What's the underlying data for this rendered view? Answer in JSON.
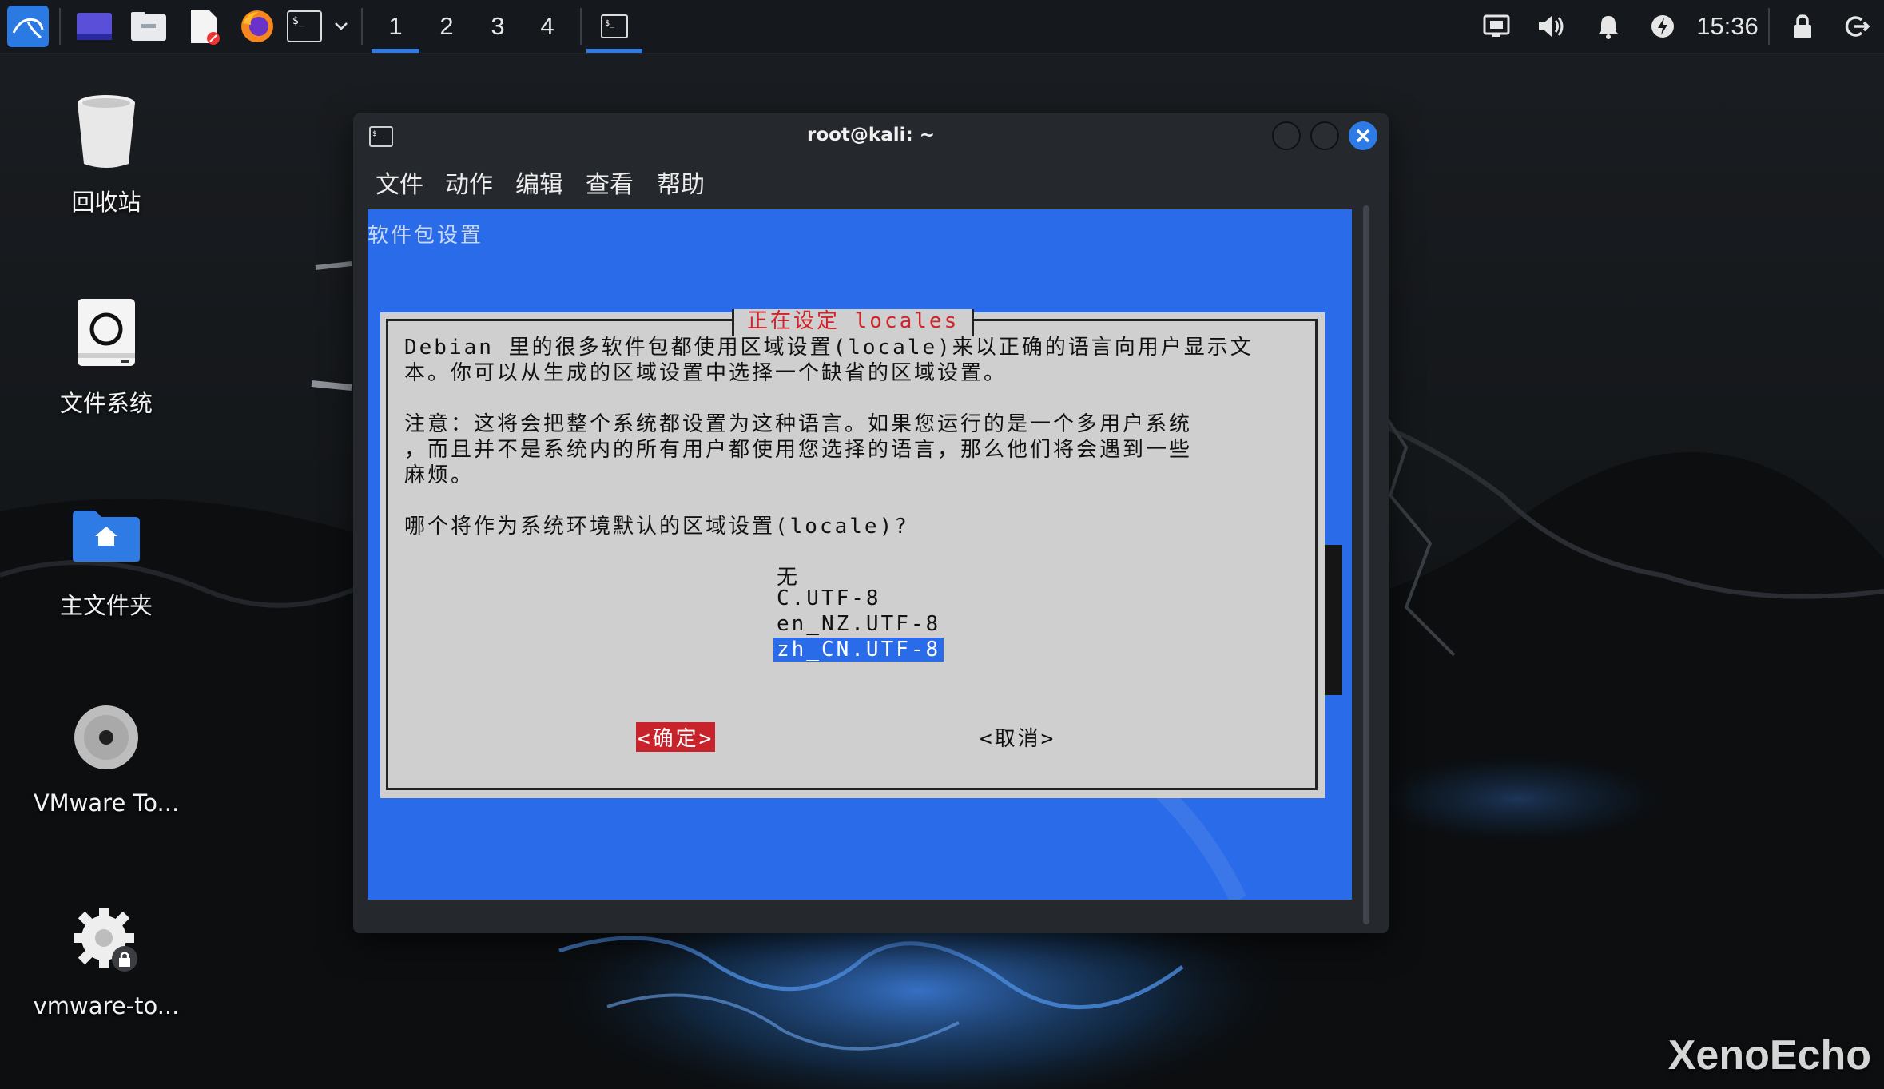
{
  "panel": {
    "workspaces": [
      "1",
      "2",
      "3",
      "4"
    ],
    "active_workspace": "1",
    "clock": "15:36",
    "icons": [
      "kali-menu-icon",
      "desktop-icon",
      "file-manager-icon",
      "text-editor-icon",
      "firefox-icon",
      "terminal-icon",
      "dropdown-chevron-icon",
      "terminal-task-icon",
      "network-icon",
      "volume-icon",
      "notification-bell-icon",
      "power-manager-icon",
      "lock-icon",
      "logout-icon"
    ]
  },
  "desktop": {
    "icons": [
      {
        "label": "回收站",
        "icon": "trash-icon"
      },
      {
        "label": "文件系统",
        "icon": "filesystem-drive-icon"
      },
      {
        "label": "主文件夹",
        "icon": "home-folder-icon"
      },
      {
        "label": "VMware To...",
        "icon": "cdrom-disc-icon"
      },
      {
        "label": "vmware-to...",
        "icon": "settings-gear-lock-icon"
      }
    ]
  },
  "window": {
    "title": "root@kali: ~",
    "menu": [
      "文件",
      "动作",
      "编辑",
      "查看",
      "帮助"
    ]
  },
  "terminal": {
    "background_title": "软件包设置",
    "dialog": {
      "title": "正在设定 locales",
      "lines": [
        "Debian 里的很多软件包都使用区域设置(locale)来以正确的语言向用户显示文",
        "本。你可以从生成的区域设置中选择一个缺省的区域设置。",
        "",
        "注意：这将会把整个系统都设置为这种语言。如果您运行的是一个多用户系统",
        "，而且并不是系统内的所有用户都使用您选择的语言，那么他们将会遇到一些",
        "麻烦。",
        "",
        "哪个将作为系统环境默认的区域设置(locale)?"
      ],
      "options": [
        "无",
        "C.UTF-8",
        "en_NZ.UTF-8",
        "zh_CN.UTF-8"
      ],
      "selected_option": "zh_CN.UTF-8",
      "ok_label": "<确定>",
      "cancel_label": "<取消>"
    }
  },
  "colors": {
    "terminal_bg": "#2a6bea",
    "dialog_bg": "#cfcfcf",
    "dialog_title": "#d1232a",
    "accent": "#2f7be6"
  },
  "watermark": "XenoEcho"
}
